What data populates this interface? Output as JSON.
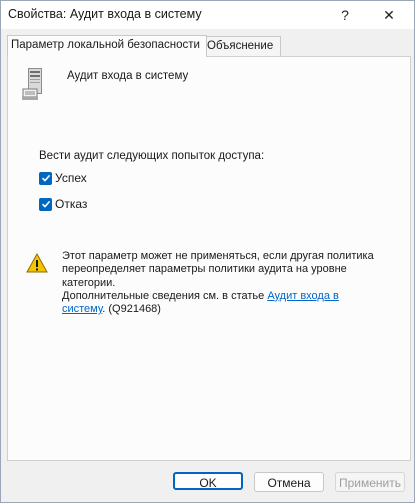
{
  "window": {
    "title": "Свойства: Аудит входа в систему",
    "help_glyph": "?",
    "close_glyph": "✕"
  },
  "tabs": [
    {
      "label": "Параметр локальной безопасности",
      "active": true
    },
    {
      "label": "Объяснение",
      "active": false
    }
  ],
  "policy": {
    "name": "Аудит входа в систему",
    "icon": "server-icon"
  },
  "audit": {
    "section_label": "Вести аудит следующих попыток доступа:",
    "success": {
      "label": "Успех",
      "checked": true
    },
    "failure": {
      "label": "Отказ",
      "checked": true
    }
  },
  "warning": {
    "icon": "warning-icon",
    "line1": "Этот параметр может не применяться, если другая политика",
    "line2": "переопределяет параметры политики аудита на уровне",
    "line3": "категории.",
    "line4_prefix": "Дополнительные сведения см. в статье ",
    "link_part1": "Аудит входа в",
    "link_part2": "систему",
    "line5_suffix": ". (Q921468)"
  },
  "buttons": {
    "ok": "OK",
    "cancel": "Отмена",
    "apply": "Применить"
  },
  "colors": {
    "accent": "#0067c0",
    "link": "#0066cc",
    "disabled_text": "#9e9e9e"
  }
}
